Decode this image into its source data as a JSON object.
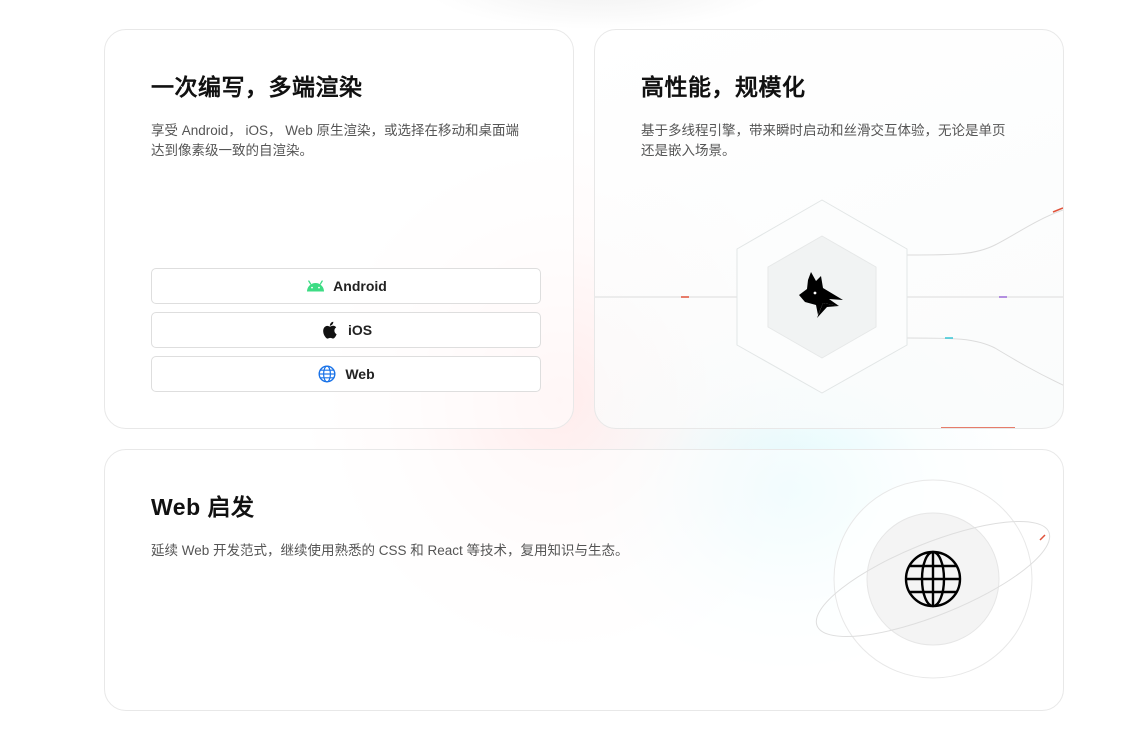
{
  "cards": {
    "cross_platform": {
      "title": "一次编写，多端渲染",
      "description": "享受 Android， iOS， Web 原生渲染，或选择在移动和桌面端达到像素级一致的自渲染。",
      "platforms": [
        {
          "label": "Android",
          "icon": "android-icon",
          "color": "#3ddc84"
        },
        {
          "label": "iOS",
          "icon": "apple-icon",
          "color": "#111111"
        },
        {
          "label": "Web",
          "icon": "globe-icon",
          "color": "#1a73e8"
        }
      ]
    },
    "performance": {
      "title": "高性能，规模化",
      "description": "基于多线程引擎，带来瞬时启动和丝滑交互体验，无论是单页还是嵌入场景。",
      "logo_icon": "lynx-cat-icon"
    },
    "web_inspired": {
      "title": "Web 启发",
      "description": "延续 Web 开发范式，继续使用熟悉的 CSS 和 React 等技术，复用知识与生态。",
      "art_icon": "globe-outline-icon"
    }
  },
  "colors": {
    "title": "#111111",
    "text": "#555555",
    "border": "#e8e8e8",
    "accent_red": "#e0523a",
    "accent_cyan": "#36c6d6",
    "accent_purple": "#9b6bd6"
  }
}
